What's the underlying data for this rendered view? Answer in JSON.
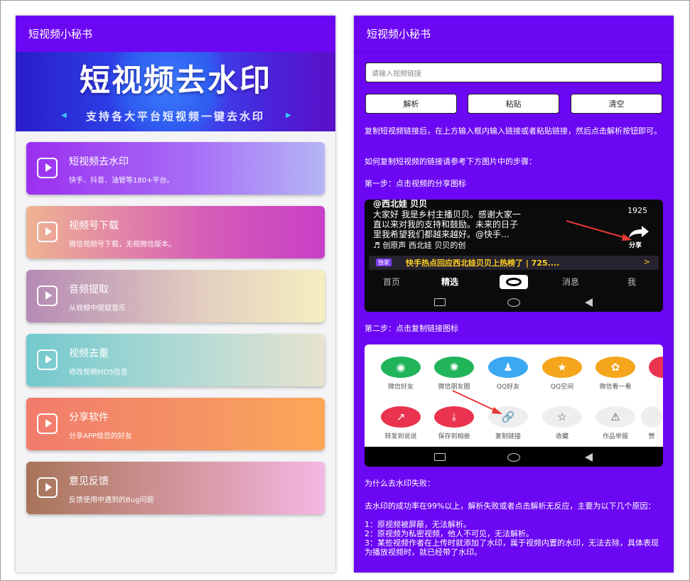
{
  "left": {
    "app_title": "短视频小秘书",
    "banner": {
      "title": "短视频去水印",
      "subtitle": "支持各大平台短视频一键去水印"
    },
    "cards": [
      {
        "title": "短视频去水印",
        "desc": "快手、抖音、油管等180+平台。"
      },
      {
        "title": "视频号下载",
        "desc": "微信视频号下载，无视微信版本。"
      },
      {
        "title": "音频提取",
        "desc": "从视频中提取音乐"
      },
      {
        "title": "视频去重",
        "desc": "修改视频MD5信息"
      },
      {
        "title": "分享软件",
        "desc": "分享APP给您的好友"
      },
      {
        "title": "意见反馈",
        "desc": "反馈使用中遇到的Bug问题"
      }
    ]
  },
  "right": {
    "app_title": "短视频小秘书",
    "input_placeholder": "请输入视频链接",
    "buttons": {
      "parse": "解析",
      "paste": "粘贴",
      "clear": "清空"
    },
    "instructions": {
      "intro": "复制短视频链接后，在上方输入框内输入链接或者粘贴链接，然后点击解析按钮即可。",
      "how_to": "如何复制短视频的链接请参考下方图片中的步骤：",
      "step1": "第一步：点击视频的分享图标",
      "step2": "第二步：点击复制链接图标",
      "why_title": "为什么去水印失败：",
      "why_body": "去水印的成功率在99%以上，解析失败或者点击解析无反应，主要为以下几个原因：",
      "reasons": [
        "1：原视频被屏蔽，无法解析。",
        "2：原视频为私密视频，他人不可见，无法解析。",
        "3：某些视频作者在上传时就添加了水印，属于视频内置的水印，无法去除，具体表现为播放视频时，就已经带了水印。"
      ]
    },
    "screenshot1": {
      "author": "@西北娃 贝贝",
      "likes": "1925",
      "caption_lines": [
        "大家好 我是乡村主播贝贝。感谢大家一",
        "直以来对我的支持和鼓励。未来的日子",
        "里我希望我们都越来越好。@快手…"
      ],
      "music": "♬ 创原声    西北娃 贝贝的创",
      "share_label": "分享",
      "news_tag": "独家",
      "news_text": "快手热点回应西北娃贝贝上热榜了 | 725....",
      "news_arrow": ">",
      "tabs": [
        "首页",
        "精选",
        "消息",
        "我"
      ]
    },
    "screenshot2": {
      "row1": [
        "微信好友",
        "微信朋友圈",
        "QQ好友",
        "QQ空间",
        "微信看一看"
      ],
      "row2": [
        "转发到说说",
        "保存到相册",
        "复制链接",
        "收藏",
        "作品举报",
        "赞"
      ]
    }
  }
}
